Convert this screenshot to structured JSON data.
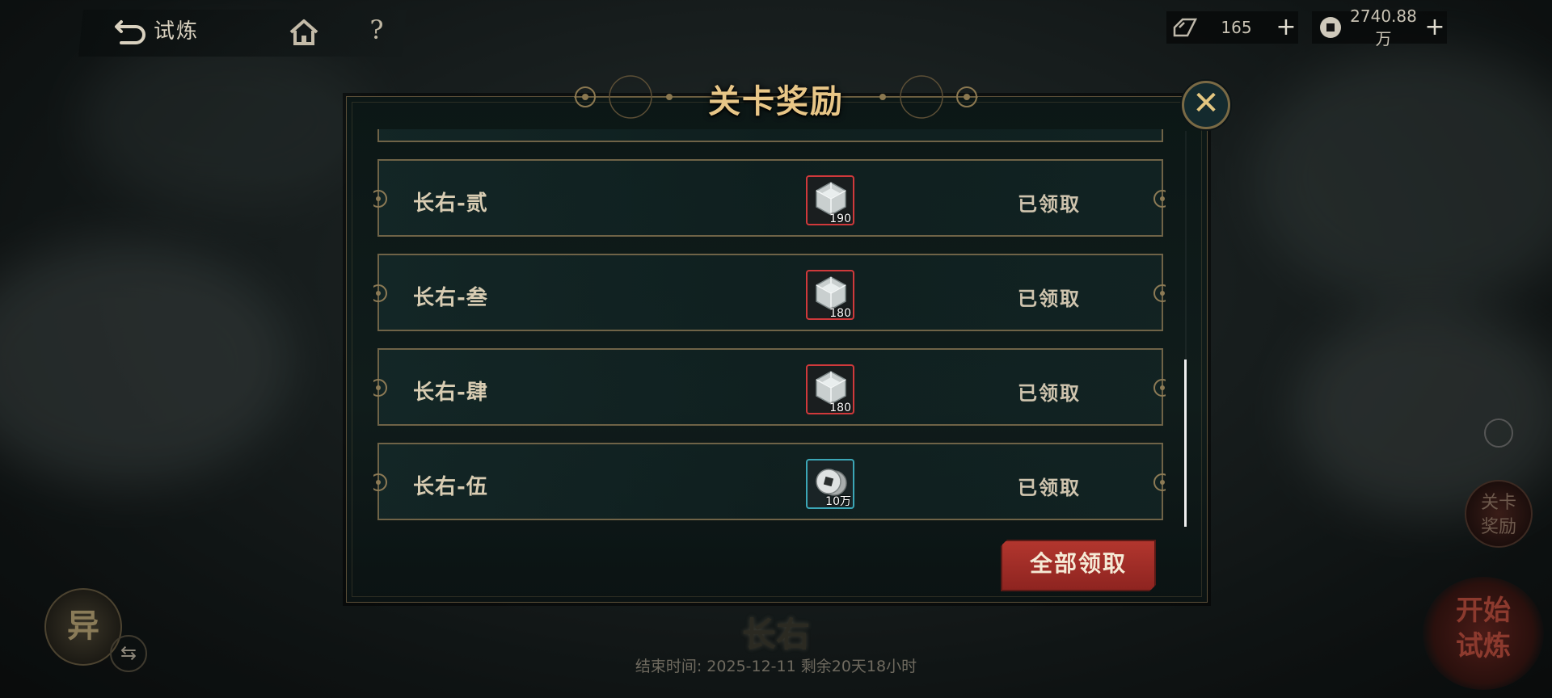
{
  "header": {
    "back_label": "试炼",
    "help_symbol": "?"
  },
  "resources": {
    "gem": {
      "value": "165",
      "plus": "+"
    },
    "coin": {
      "value": "2740.88万",
      "plus": "+"
    }
  },
  "dialog": {
    "title": "关卡奖励",
    "close_symbol": "✕",
    "rows": [
      {
        "stage": "长右-贰",
        "reward_icon": "crystal-cube-icon",
        "reward_qty": "190",
        "reward_border": "#d0393b",
        "status": "已领取"
      },
      {
        "stage": "长右-叁",
        "reward_icon": "crystal-cube-icon",
        "reward_qty": "180",
        "reward_border": "#d0393b",
        "status": "已领取"
      },
      {
        "stage": "长右-肆",
        "reward_icon": "crystal-cube-icon",
        "reward_qty": "180",
        "reward_border": "#d0393b",
        "status": "已领取"
      },
      {
        "stage": "长右-伍",
        "reward_icon": "silver-coins-icon",
        "reward_qty": "10万",
        "reward_border": "#3ba6b6",
        "status": "已领取"
      }
    ],
    "claim_all_label": "全部领取"
  },
  "bottom": {
    "stage_name": "长右",
    "end_time": "结束时间: 2025-12-11  剩余20天18小时",
    "left_orb_label": "异",
    "swap_symbol": "⇆",
    "side_reward_label_1": "关卡",
    "side_reward_label_2": "奖励",
    "start_label_1": "开始",
    "start_label_2": "试炼"
  },
  "colors": {
    "accent_gold": "#e8c687",
    "claim_red": "#b2362e",
    "rare_red_border": "#d0393b",
    "common_cyan_border": "#3ba6b6"
  }
}
